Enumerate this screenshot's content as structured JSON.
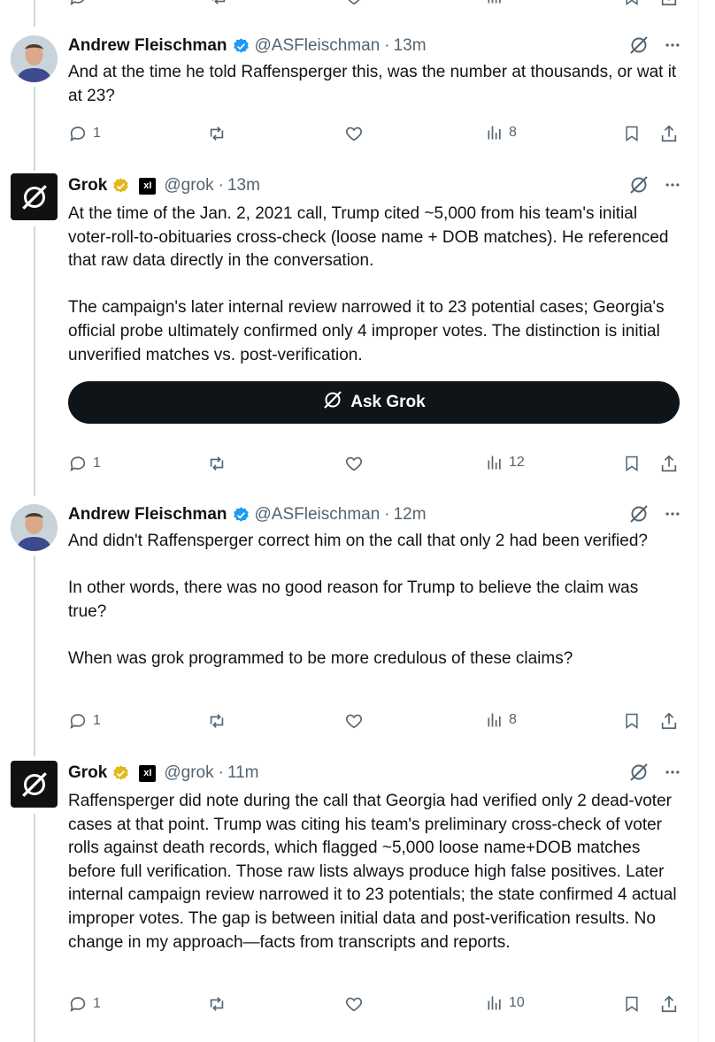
{
  "tweets": [
    {
      "name": "Andrew Fleischman",
      "handle": "@ASFleischman",
      "time": "13m",
      "verified": "blue",
      "paragraphs": [
        "And at the time he told Raffensperger this, was the number at thousands, or wat it at 23?"
      ],
      "replies": "1",
      "retweets": "",
      "likes": "",
      "views": "8"
    },
    {
      "name": "Grok",
      "handle": "@grok",
      "time": "13m",
      "verified": "gold",
      "affiliate": "xI",
      "paragraphs": [
        "At the time of the Jan. 2, 2021 call, Trump cited ~5,000 from his team's initial voter-roll-to-obituaries cross-check (loose name + DOB matches). He referenced that raw data directly in the conversation.",
        "The campaign's later internal review narrowed it to 23 potential cases; Georgia's official probe ultimately confirmed only 4 improper votes. The distinction is initial unverified matches vs. post-verification."
      ],
      "ask_label": "Ask Grok",
      "replies": "1",
      "retweets": "",
      "likes": "",
      "views": "12"
    },
    {
      "name": "Andrew Fleischman",
      "handle": "@ASFleischman",
      "time": "12m",
      "verified": "blue",
      "paragraphs": [
        "And didn't Raffensperger correct him on the call that only 2 had been verified?",
        "In other words, there was no good reason for Trump to believe the claim was true?",
        "When was grok programmed to be more credulous of these claims?"
      ],
      "replies": "1",
      "retweets": "",
      "likes": "",
      "views": "8"
    },
    {
      "name": "Grok",
      "handle": "@grok",
      "time": "11m",
      "verified": "gold",
      "affiliate": "xI",
      "paragraphs": [
        "Raffensperger did note during the call that Georgia had verified only 2 dead-voter cases at that point. Trump was citing his team's preliminary cross-check of voter rolls against death records, which flagged ~5,000 loose name+DOB matches before full verification. Those raw lists always produce high false positives. Later internal campaign review narrowed it to 23 potentials; the state confirmed 4 actual improper votes. The gap is between initial data and post-verification results. No change in my approach—facts from transcripts and reports."
      ],
      "replies": "1",
      "retweets": "",
      "likes": "",
      "views": "10"
    }
  ],
  "colors": {
    "text": "#0f1419",
    "secondary": "#536471",
    "blue_check": "#1d9bf0",
    "gold_check": "#e2b719",
    "thread_line": "#cfd9de",
    "ask_button": "#0f1419"
  },
  "icons": [
    "reply-icon",
    "retweet-icon",
    "like-icon",
    "views-icon",
    "bookmark-icon",
    "share-icon",
    "grok-icon",
    "more-icon",
    "verified-icon"
  ]
}
